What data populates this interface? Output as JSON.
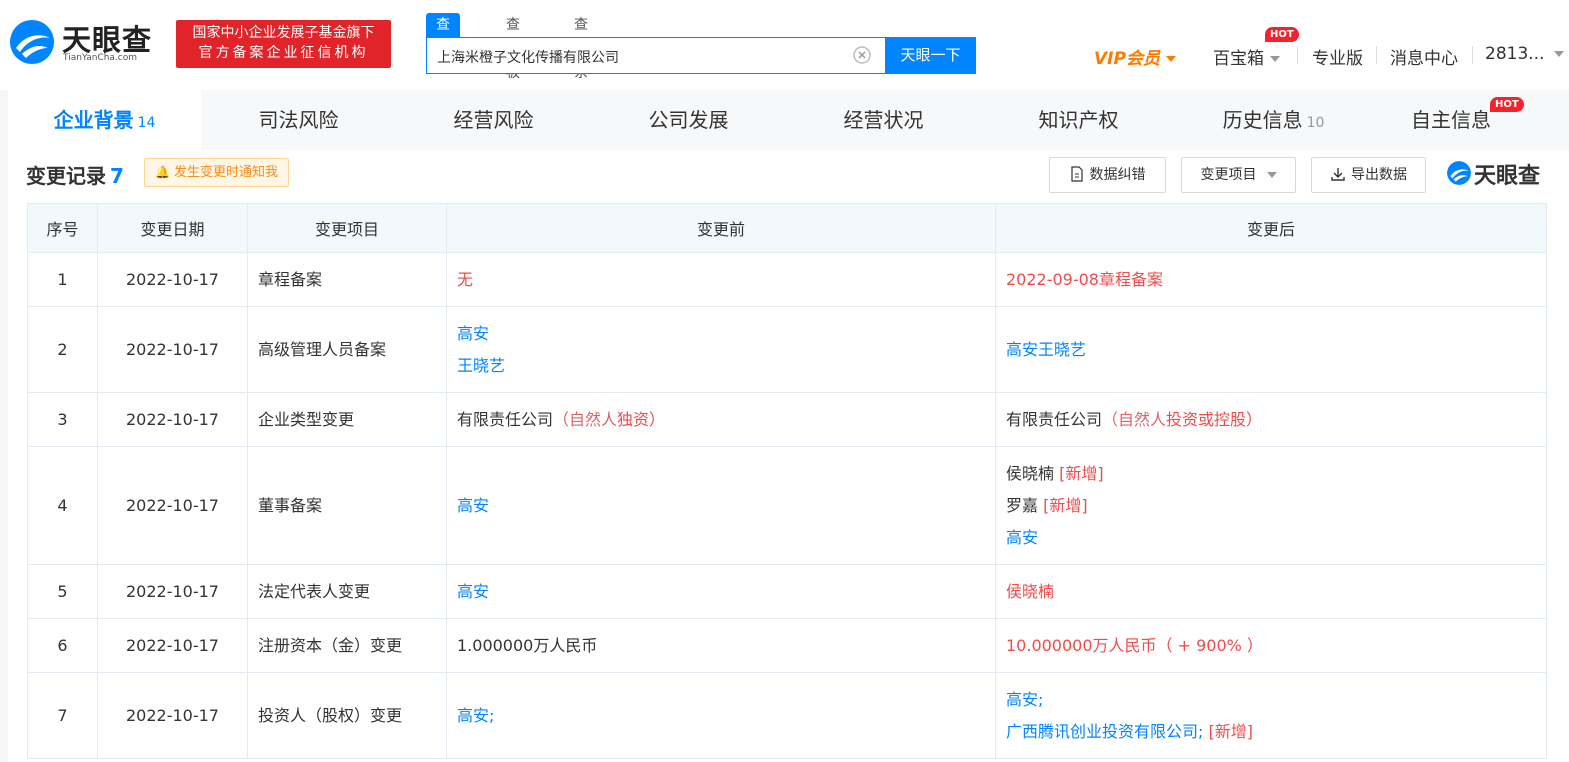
{
  "brand": {
    "name": "天眼查",
    "domain_text": "TianYanCha.com",
    "badge_line1": "国家中小企业发展子基金旗下",
    "badge_line2": "官方备案企业征信机构"
  },
  "search": {
    "tabs": [
      "查公司",
      "查老板",
      "查关系"
    ],
    "value": "上海米橙子文化传播有限公司",
    "button": "天眼一下"
  },
  "nav": {
    "vip": "VIP会员",
    "treasure": "百宝箱",
    "hot": "HOT",
    "pro": "专业版",
    "messages": "消息中心",
    "user": "2813..."
  },
  "tabs": [
    {
      "label": "企业背景",
      "count": "14"
    },
    {
      "label": "司法风险",
      "count": ""
    },
    {
      "label": "经营风险",
      "count": ""
    },
    {
      "label": "公司发展",
      "count": ""
    },
    {
      "label": "经营状况",
      "count": ""
    },
    {
      "label": "知识产权",
      "count": ""
    },
    {
      "label": "历史信息",
      "count": "10"
    },
    {
      "label": "自主信息",
      "count": ""
    }
  ],
  "tab_hot": "HOT",
  "section": {
    "title": "变更记录",
    "count": "7",
    "notify": "发生变更时通知我",
    "btn_correct": "数据纠错",
    "btn_filter": "变更项目",
    "btn_export": "导出数据",
    "logo": "天眼查"
  },
  "table": {
    "headers": [
      "序号",
      "变更日期",
      "变更项目",
      "变更前",
      "变更后"
    ],
    "rows": [
      {
        "idx": "1",
        "date": "2022-10-17",
        "item": "章程备案"
      },
      {
        "idx": "2",
        "date": "2022-10-17",
        "item": "高级管理人员备案"
      },
      {
        "idx": "3",
        "date": "2022-10-17",
        "item": "企业类型变更"
      },
      {
        "idx": "4",
        "date": "2022-10-17",
        "item": "董事备案"
      },
      {
        "idx": "5",
        "date": "2022-10-17",
        "item": "法定代表人变更"
      },
      {
        "idx": "6",
        "date": "2022-10-17",
        "item": "注册资本（金）变更"
      },
      {
        "idx": "7",
        "date": "2022-10-17",
        "item": "投资人（股权）变更"
      }
    ],
    "r1_before": "无",
    "r1_after": "2022-09-08章程备案",
    "r2_before_1": "高安",
    "r2_before_2": "王晓艺",
    "r2_after": "高安王晓艺",
    "r3_before_a": "有限责任公司",
    "r3_before_b": "（自然人",
    "r3_before_c": "独资",
    "r3_before_d": "）",
    "r3_after_a": "有限责任公司",
    "r3_after_b": "（自然人",
    "r3_after_c": "投资或控股",
    "r3_after_d": "）",
    "r4_before": "高安",
    "r4_after_1_name": "侯晓楠",
    "r4_after_1_tag": "[新增]",
    "r4_after_2_name": "罗嘉",
    "r4_after_2_tag": "[新增]",
    "r4_after_3_name": "高安",
    "r5_before": "高安",
    "r5_after": "侯晓楠",
    "r6_before": "1.000000万人民币",
    "r6_after": "10.000000万人民币（ + 900% ）",
    "r7_before": "高安;",
    "r7_after_1": "高安;",
    "r7_after_2": "广西腾讯创业投资有限公司;",
    "r7_after_2_tag": "[新增]"
  },
  "colors": {
    "accent": "#0084ff",
    "change_red": "#f04c4c",
    "brand_red": "#e1242a",
    "vip_orange": "#ff7a00"
  },
  "icons": [
    "tianyancha-logo-icon",
    "clear-icon",
    "chevron-down-icon",
    "bell-icon",
    "document-icon",
    "download-icon"
  ]
}
